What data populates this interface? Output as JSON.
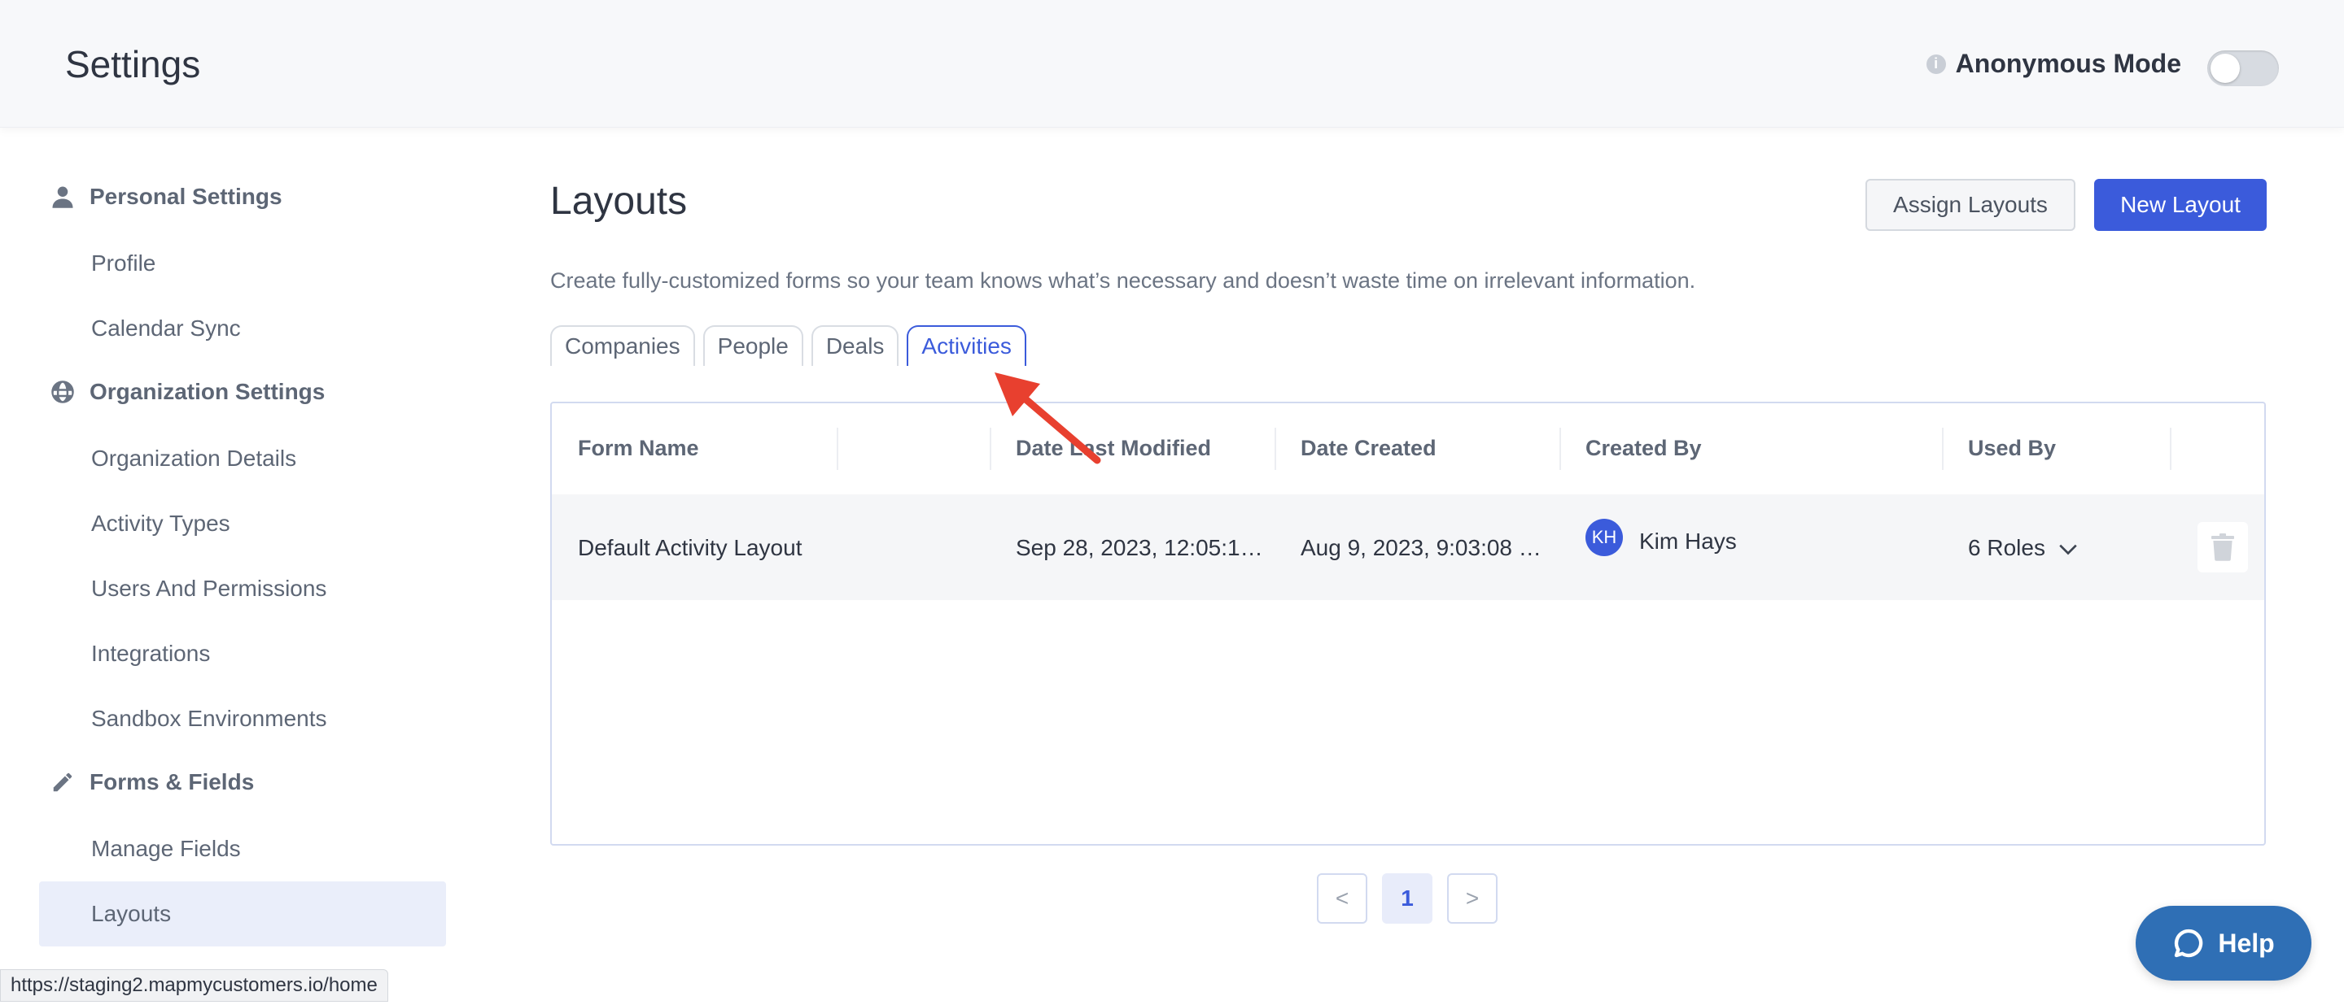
{
  "header": {
    "title": "Settings",
    "anonymous_mode_label": "Anonymous Mode",
    "anonymous_mode_enabled": false
  },
  "sidebar": {
    "sections": [
      {
        "label": "Personal Settings",
        "icon": "user-icon",
        "items": [
          "Profile",
          "Calendar Sync"
        ]
      },
      {
        "label": "Organization Settings",
        "icon": "globe-icon",
        "items": [
          "Organization Details",
          "Activity Types",
          "Users And Permissions",
          "Integrations",
          "Sandbox Environments"
        ]
      },
      {
        "label": "Forms & Fields",
        "icon": "pencil-icon",
        "items": [
          "Manage Fields",
          "Layouts"
        ]
      }
    ],
    "active_item": "Layouts"
  },
  "main": {
    "title": "Layouts",
    "description": "Create fully-customized forms so your team knows what’s necessary and doesn’t waste time on irrelevant information.",
    "assign_button": "Assign Layouts",
    "new_button": "New Layout",
    "tabs": [
      "Companies",
      "People",
      "Deals",
      "Activities"
    ],
    "active_tab": "Activities",
    "table": {
      "columns": [
        "Form Name",
        "Date Last Modified",
        "Date Created",
        "Created By",
        "Used By"
      ],
      "rows": [
        {
          "form_name": "Default Activity Layout",
          "date_last_modified": "Sep 28, 2023, 12:05:1…",
          "date_created": "Aug 9, 2023, 9:03:08 …",
          "creator_initials": "KH",
          "created_by": "Kim Hays",
          "used_by": "6 Roles"
        }
      ]
    },
    "pagination": {
      "prev": "<",
      "current": "1",
      "next": ">"
    }
  },
  "help_label": "Help",
  "status_url": "https://staging2.mapmycustomers.io/home",
  "colors": {
    "accent": "#3b5bdb",
    "help": "#2f6fb5",
    "annotation_arrow": "#e8402f"
  }
}
